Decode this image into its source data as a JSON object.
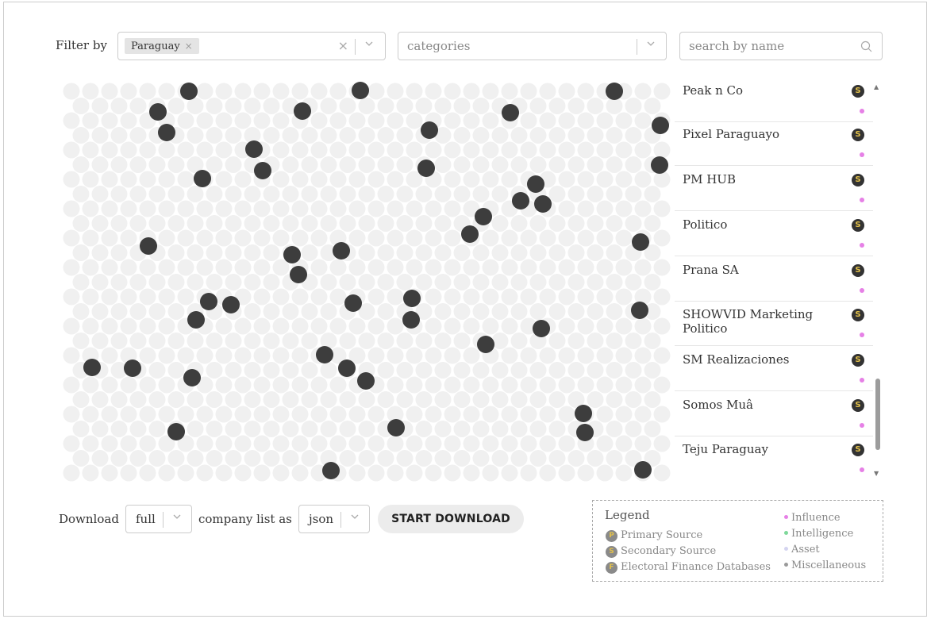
{
  "filter": {
    "label": "Filter by",
    "country_chip": "Paraguay",
    "chip_remove": "×",
    "clear": "×",
    "categories_placeholder": "categories",
    "search_placeholder": "search by name"
  },
  "companies": [
    {
      "name": "Peak n Co",
      "source": "S"
    },
    {
      "name": "Pixel Paraguayo",
      "source": "S"
    },
    {
      "name": "PM HUB",
      "source": "S"
    },
    {
      "name": "Politico",
      "source": "S"
    },
    {
      "name": "Prana SA",
      "source": "S"
    },
    {
      "name": "SHOWVID Marketing Politico",
      "source": "S"
    },
    {
      "name": "SM Realizaciones",
      "source": "S"
    },
    {
      "name": "Somos Muâ",
      "source": "S"
    },
    {
      "name": "Teju Paraguay",
      "source": "S"
    }
  ],
  "download": {
    "label": "Download",
    "scope": "full",
    "middle_label": "company list as",
    "format": "json",
    "button": "START DOWNLOAD"
  },
  "legend": {
    "title": "Legend",
    "sources": [
      {
        "letter": "P",
        "label": "Primary Source"
      },
      {
        "letter": "S",
        "label": "Secondary Source"
      },
      {
        "letter": "F",
        "label": "Electoral Finance Databases"
      }
    ],
    "categories": [
      {
        "label": "Influence",
        "color": "#e680e6"
      },
      {
        "label": "Intelligence",
        "color": "#7ed89a"
      },
      {
        "label": "Asset",
        "color": "#d4d4f0"
      },
      {
        "label": "Miscellaneous",
        "color": "#9a9a9a"
      }
    ]
  },
  "colors": {
    "bubble_inactive": "#f0f0f0",
    "bubble_active": "#3d3d3d",
    "influence_dot": "#e680e6",
    "badge_letter": "#e3c14a"
  },
  "icons": {
    "search": "search-icon",
    "dropdown": "chevron-down-icon"
  }
}
